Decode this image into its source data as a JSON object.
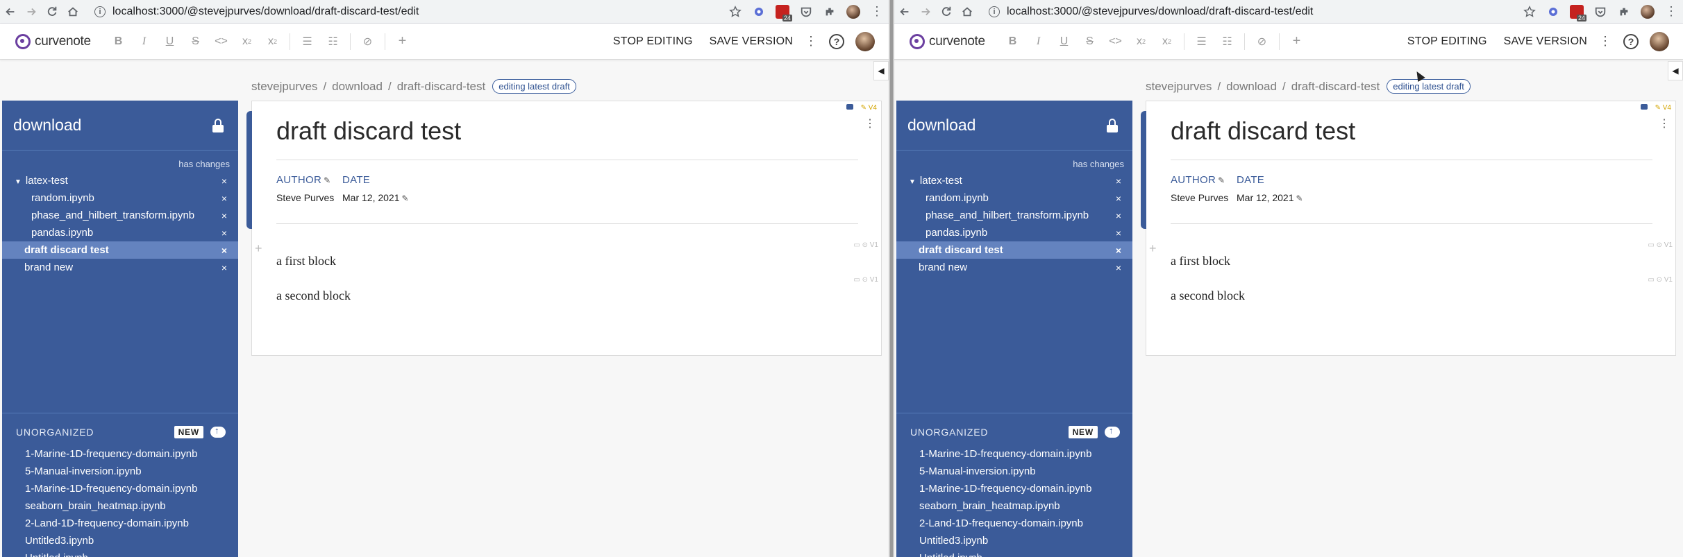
{
  "browser": {
    "url": "localhost:3000/@stevejpurves/download/draft-discard-test/edit",
    "ext_badge_count": "24"
  },
  "app": {
    "logo": "curvenote",
    "stop_editing": "STOP EDITING",
    "save_version": "SAVE VERSION",
    "help": "?"
  },
  "breadcrumb": {
    "items": [
      "stevejpurves",
      "download",
      "draft-discard-test"
    ],
    "separator": "/",
    "badge": "editing latest draft"
  },
  "sidebar": {
    "title": "download",
    "has_changes": "has changes",
    "tree": [
      {
        "label": "latex-test",
        "indent": 0,
        "expanded": true,
        "selected": false
      },
      {
        "label": "random.ipynb",
        "indent": 1,
        "selected": false
      },
      {
        "label": "phase_and_hilbert_transform.ipynb",
        "indent": 1,
        "selected": false
      },
      {
        "label": "pandas.ipynb",
        "indent": 1,
        "selected": false
      },
      {
        "label": "draft discard test",
        "indent": 0,
        "selected": true
      },
      {
        "label": "brand new",
        "indent": 0,
        "selected": false
      }
    ],
    "remove_glyph": "×",
    "unorganized": {
      "heading": "UNORGANIZED",
      "new_label": "NEW",
      "items": [
        "1-Marine-1D-frequency-domain.ipynb",
        "5-Manual-inversion.ipynb",
        "1-Marine-1D-frequency-domain.ipynb",
        "seaborn_brain_heatmap.ipynb",
        "2-Land-1D-frequency-domain.ipynb",
        "Untitled3.ipynb",
        "Untitled.ipynb"
      ]
    }
  },
  "document": {
    "title": "draft discard test",
    "author_label": "AUTHOR",
    "date_label": "DATE",
    "author": "Steve Purves",
    "date": "Mar 12, 2021",
    "version_tag": "V4",
    "block_version": "V1",
    "blocks": [
      "a first block",
      "a second block"
    ]
  }
}
